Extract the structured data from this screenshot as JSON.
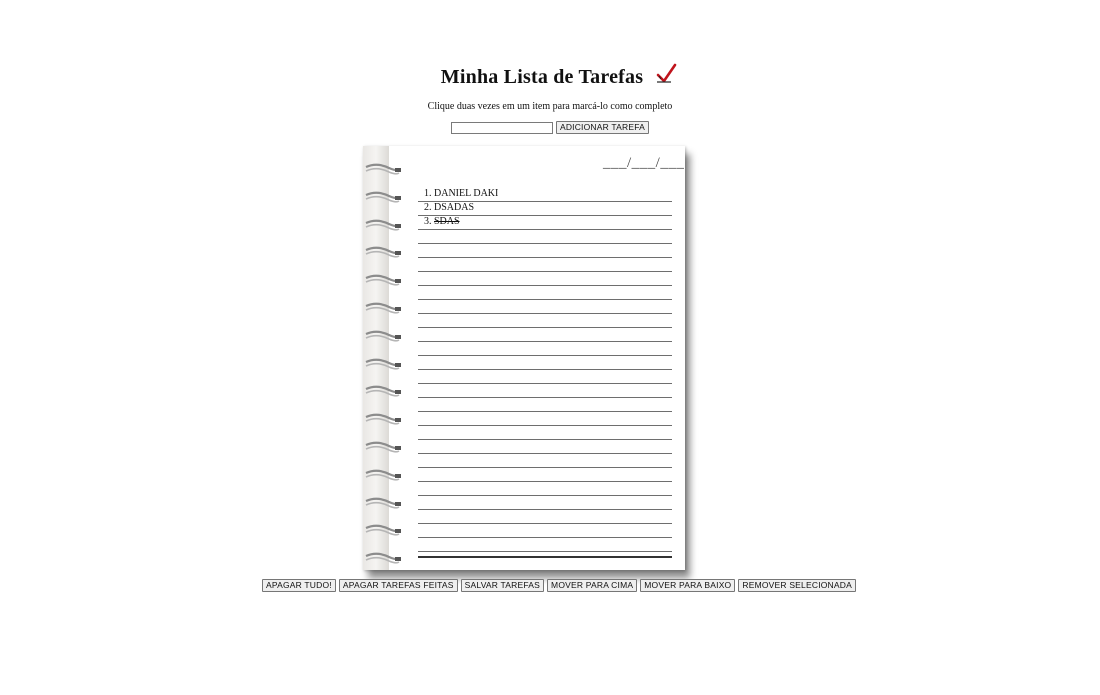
{
  "header": {
    "title": "Minha Lista de Tarefas",
    "icon": "check-icon",
    "subtitle": "Clique duas vezes em um item para marcá-lo como completo"
  },
  "add_form": {
    "input_value": "",
    "add_button_label": "ADICIONAR TAREFA"
  },
  "notebook": {
    "date_placeholder": "___/___/___",
    "tasks": [
      {
        "text": "DANIEL DAKI",
        "done": false
      },
      {
        "text": "DSADAS",
        "done": false
      },
      {
        "text": "SDAS",
        "done": true
      }
    ]
  },
  "actions": {
    "clear_all": "APAGAR TUDO!",
    "clear_done": "APAGAR TAREFAS FEITAS",
    "save": "SALVAR TAREFAS",
    "move_up": "MOVER PARA CIMA",
    "move_down": "MOVER PARA BAIXO",
    "remove_selected": "REMOVER SELECIONADA"
  },
  "colors": {
    "accent_check": "#c0141c",
    "ruled_line": "#6e6e6e"
  }
}
